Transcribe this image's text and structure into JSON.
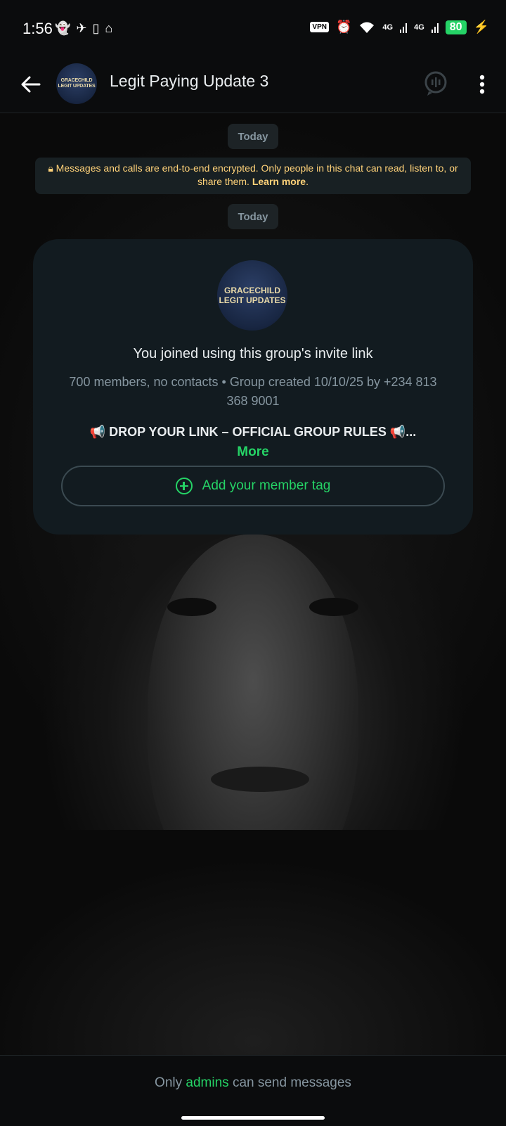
{
  "status_bar": {
    "time": "1:56",
    "vpn": "VPN",
    "network1": "4G",
    "network2": "4G",
    "battery": "80"
  },
  "header": {
    "title": "Legit Paying Update 3",
    "avatar_text": "GRACECHILD LEGIT UPDATES"
  },
  "chat": {
    "date_pill_1": "Today",
    "encryption_text": "Messages and calls are end-to-end encrypted. Only people in this chat can read, listen to, or share them.",
    "learn_more": "Learn more",
    "date_pill_2": "Today"
  },
  "group_card": {
    "avatar_text": "GRACECHILD LEGIT UPDATES",
    "joined_text": "You joined using this group's invite link",
    "meta_text": "700 members, no contacts • Group created 10/10/25 by +234 813 368 9001",
    "rules_text": "📢 DROP YOUR LINK – OFFICIAL GROUP RULES 📢...",
    "more_label": "More",
    "add_tag_label": "Add your member tag"
  },
  "footer": {
    "notice_prefix": "Only",
    "notice_link": "admins",
    "notice_suffix": "can send messages"
  },
  "colors": {
    "accent": "#25d366",
    "encryption_text": "#ffd279",
    "background": "#0b0c0d",
    "card": "#121b20"
  }
}
